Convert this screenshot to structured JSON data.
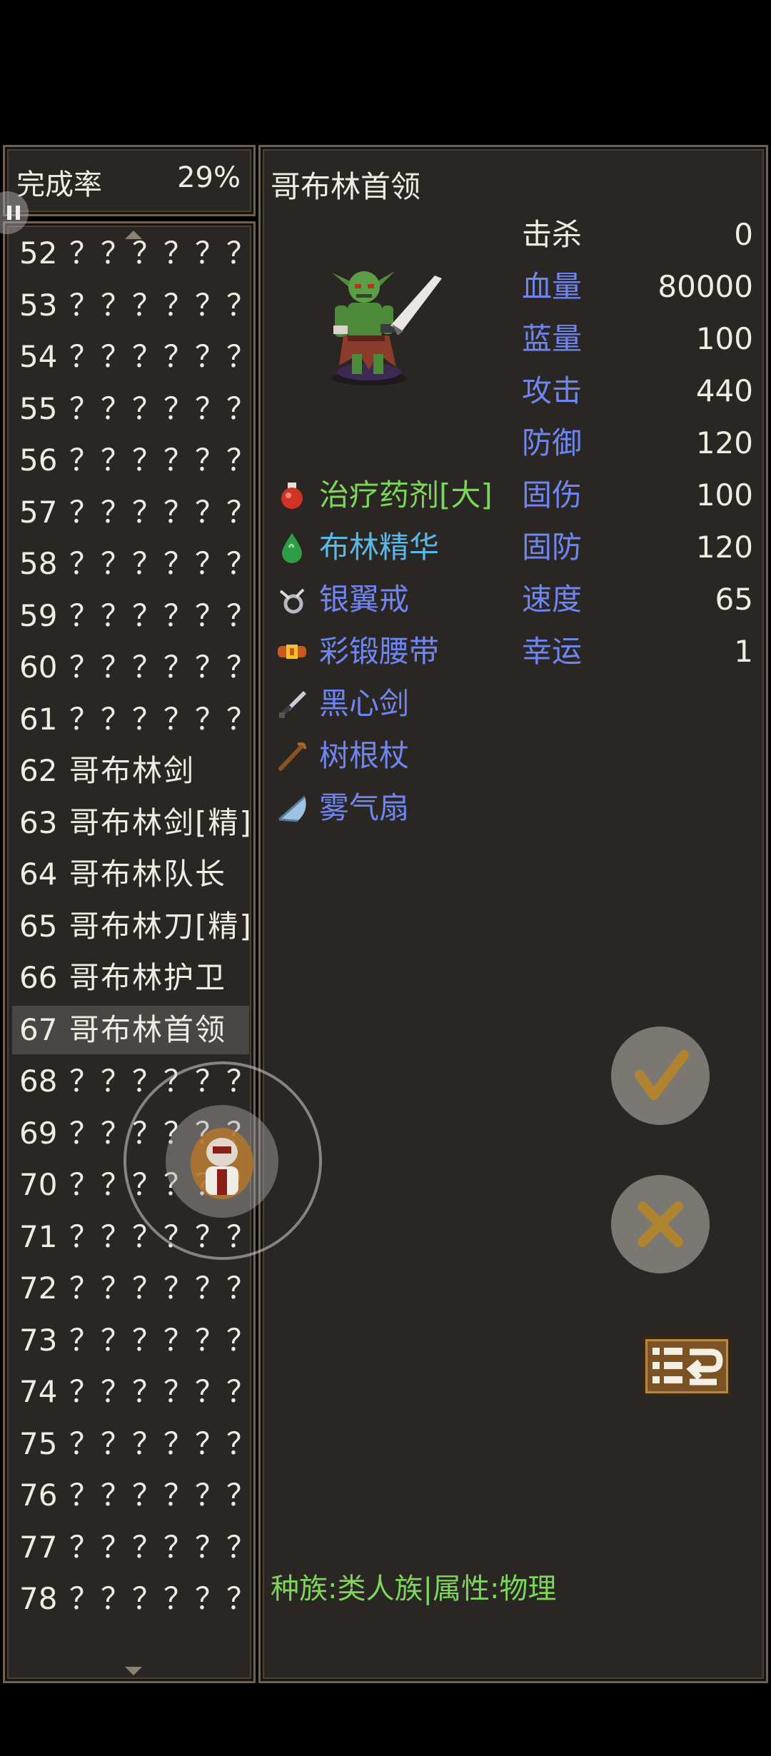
{
  "completion": {
    "label": "完成率",
    "value": "29%"
  },
  "list": [
    {
      "num": "52",
      "name": "？？？？？？"
    },
    {
      "num": "53",
      "name": "？？？？？？"
    },
    {
      "num": "54",
      "name": "？？？？？？"
    },
    {
      "num": "55",
      "name": "？？？？？？"
    },
    {
      "num": "56",
      "name": "？？？？？？"
    },
    {
      "num": "57",
      "name": "？？？？？？"
    },
    {
      "num": "58",
      "name": "？？？？？？"
    },
    {
      "num": "59",
      "name": "？？？？？？"
    },
    {
      "num": "60",
      "name": "？？？？？？"
    },
    {
      "num": "61",
      "name": "？？？？？？"
    },
    {
      "num": "62",
      "name": "哥布林剑"
    },
    {
      "num": "63",
      "name": "哥布林剑[精]"
    },
    {
      "num": "64",
      "name": "哥布林队长"
    },
    {
      "num": "65",
      "name": "哥布林刀[精]"
    },
    {
      "num": "66",
      "name": "哥布林护卫"
    },
    {
      "num": "67",
      "name": "哥布林首领"
    },
    {
      "num": "68",
      "name": "？？？？？？"
    },
    {
      "num": "69",
      "name": "？？？？？？"
    },
    {
      "num": "70",
      "name": "？？？？？？"
    },
    {
      "num": "71",
      "name": "？？？？？？"
    },
    {
      "num": "72",
      "name": "？？？？？？"
    },
    {
      "num": "73",
      "name": "？？？？？？"
    },
    {
      "num": "74",
      "name": "？？？？？？"
    },
    {
      "num": "75",
      "name": "？？？？？？"
    },
    {
      "num": "76",
      "name": "？？？？？？"
    },
    {
      "num": "77",
      "name": "？？？？？？"
    },
    {
      "num": "78",
      "name": "？？？？？？"
    }
  ],
  "selected_num": "67",
  "detail": {
    "name": "哥布林首领",
    "drops": [
      {
        "name": "治疗药剂[大]",
        "color": "#7cd65a",
        "icon": "potion-icon"
      },
      {
        "name": "布林精华",
        "color": "#5ab8e6",
        "icon": "essence-drop-icon"
      },
      {
        "name": "银翼戒",
        "color": "#6f86f0",
        "icon": "ring-icon"
      },
      {
        "name": "彩锻腰带",
        "color": "#6f86f0",
        "icon": "belt-icon"
      },
      {
        "name": "黑心剑",
        "color": "#6f86f0",
        "icon": "sword-icon"
      },
      {
        "name": "树根杖",
        "color": "#6f86f0",
        "icon": "staff-icon"
      },
      {
        "name": "雾气扇",
        "color": "#6f86f0",
        "icon": "fan-icon"
      }
    ],
    "stats": [
      {
        "label": "击杀",
        "value": "0",
        "color": "#f1ece2"
      },
      {
        "label": "血量",
        "value": "80000",
        "color": "#6f86f0"
      },
      {
        "label": "蓝量",
        "value": "100",
        "color": "#6f86f0"
      },
      {
        "label": "攻击",
        "value": "440",
        "color": "#6f86f0"
      },
      {
        "label": "防御",
        "value": "120",
        "color": "#6f86f0"
      },
      {
        "label": "固伤",
        "value": "100",
        "color": "#6f86f0"
      },
      {
        "label": "固防",
        "value": "120",
        "color": "#6f86f0"
      },
      {
        "label": "速度",
        "value": "65",
        "color": "#6f86f0"
      },
      {
        "label": "幸运",
        "value": "1",
        "color": "#6f86f0"
      }
    ],
    "race_info": "种族:类人族|属性:物理"
  },
  "buttons": {
    "confirm_icon": "checkmark-icon",
    "cancel_icon": "close-icon",
    "toggle_icon": "list-toggle-icon"
  }
}
